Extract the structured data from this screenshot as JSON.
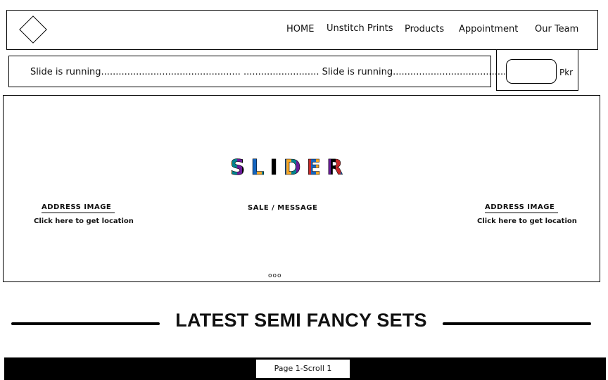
{
  "nav": {
    "items": [
      {
        "label": "HOME"
      },
      {
        "label": "Unstitch Prints"
      },
      {
        "label": "Products"
      },
      {
        "label": "Appointment"
      },
      {
        "label": "Our Team"
      }
    ]
  },
  "icons": {
    "logo": "diamond-logo-icon"
  },
  "marquee": {
    "text": "Slide is running................................................ .......................... Slide is running.............................................."
  },
  "currency": {
    "value": "",
    "label": "Pkr"
  },
  "slider": {
    "title": "SLIDER",
    "title_colors": [
      "#c62828",
      "#1565c0",
      "#f9a825",
      "#00838f",
      "#6a1b9a",
      "#000000"
    ],
    "left_address": {
      "title": "ADDRESS IMAGE",
      "link": "Click here to get location"
    },
    "center_message": "SALE / MESSAGE",
    "right_address": {
      "title": "ADDRESS IMAGE",
      "link": "Click here to get location"
    },
    "dots": "ooo"
  },
  "section": {
    "heading": "LATEST SEMI FANCY SETS"
  },
  "footer": {
    "page_label": "Page 1-Scroll 1"
  }
}
